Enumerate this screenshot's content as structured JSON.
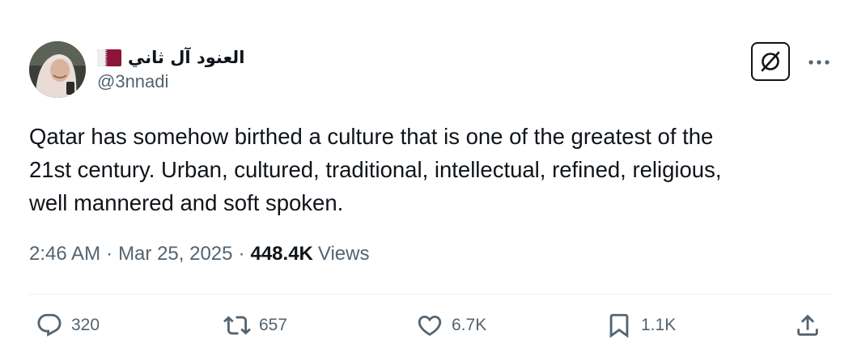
{
  "author": {
    "display_name": "العنود آل ثاني",
    "handle": "@3nnadi",
    "flag_icon": "qatar-flag-icon"
  },
  "tweet": {
    "text": "Qatar has somehow birthed a culture that is one of the greatest of the\n21st century. Urban, cultured, traditional, intellectual, refined, religious,\nwell mannered and soft spoken."
  },
  "meta": {
    "time": "2:46 AM",
    "separator": "·",
    "date": "Mar 25, 2025",
    "views_count": "448.4K",
    "views_label": "Views"
  },
  "actions": {
    "replies": "320",
    "reposts": "657",
    "likes": "6.7K",
    "bookmarks": "1.1K"
  },
  "colors": {
    "text_primary": "#0f1419",
    "text_secondary": "#536471",
    "divider": "#eff3f4",
    "flag_maroon": "#8a1538"
  }
}
